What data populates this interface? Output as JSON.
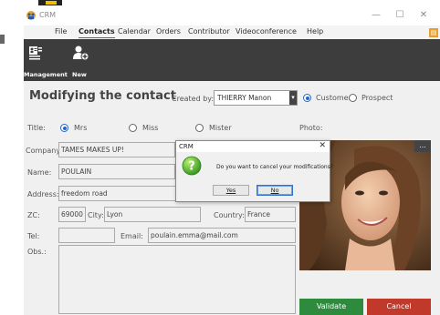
{
  "app": {
    "title": "CRM"
  },
  "menu": {
    "items": [
      "File",
      "Contacts",
      "Calendar",
      "Orders",
      "Contributor",
      "Videoconference",
      "Help"
    ],
    "active": "Contacts"
  },
  "toolbar": {
    "management_label": "Management",
    "new_label": "New"
  },
  "form": {
    "title": "Modifying the contact",
    "created_by_label": "Created by:",
    "created_by_value": "THIERRY Manon",
    "type_options": [
      "Customer",
      "Prospect"
    ],
    "type_selected": "Customer",
    "title_label": "Title:",
    "title_options": [
      "Mrs",
      "Miss",
      "Mister"
    ],
    "title_selected": "Mrs",
    "photo_label": "Photo:",
    "company_label": "Company:",
    "company_value": "TAMES MAKES UP!",
    "name_label": "Name:",
    "name_value": "POULAIN",
    "address_label": "Address:",
    "address_value": "freedom road",
    "zc_label": "ZC:",
    "zc_value": "69000",
    "city_label": "City:",
    "city_value": "Lyon",
    "country_label": "Country:",
    "country_value": "France",
    "tel_label": "Tel:",
    "tel_value": "",
    "email_label": "Email:",
    "email_value": "poulain.emma@mail.com",
    "obs_label": "Obs.:",
    "obs_value": "",
    "photo_more": "...",
    "validate_label": "Validate",
    "cancel_label": "Cancel"
  },
  "dialog": {
    "title": "CRM",
    "close": "✕",
    "message": "Do you want to cancel your modifications?",
    "yes_label": "Yes",
    "no_label": "No"
  },
  "window": {
    "min": "—",
    "max": "☐",
    "close": "✕"
  },
  "colors": {
    "toolbar_bg": "#3d3d3d",
    "validate": "#2e8b3e",
    "cancel": "#c0392b",
    "radio_accent": "#2266cc",
    "menu_badge": "#e5a030"
  }
}
